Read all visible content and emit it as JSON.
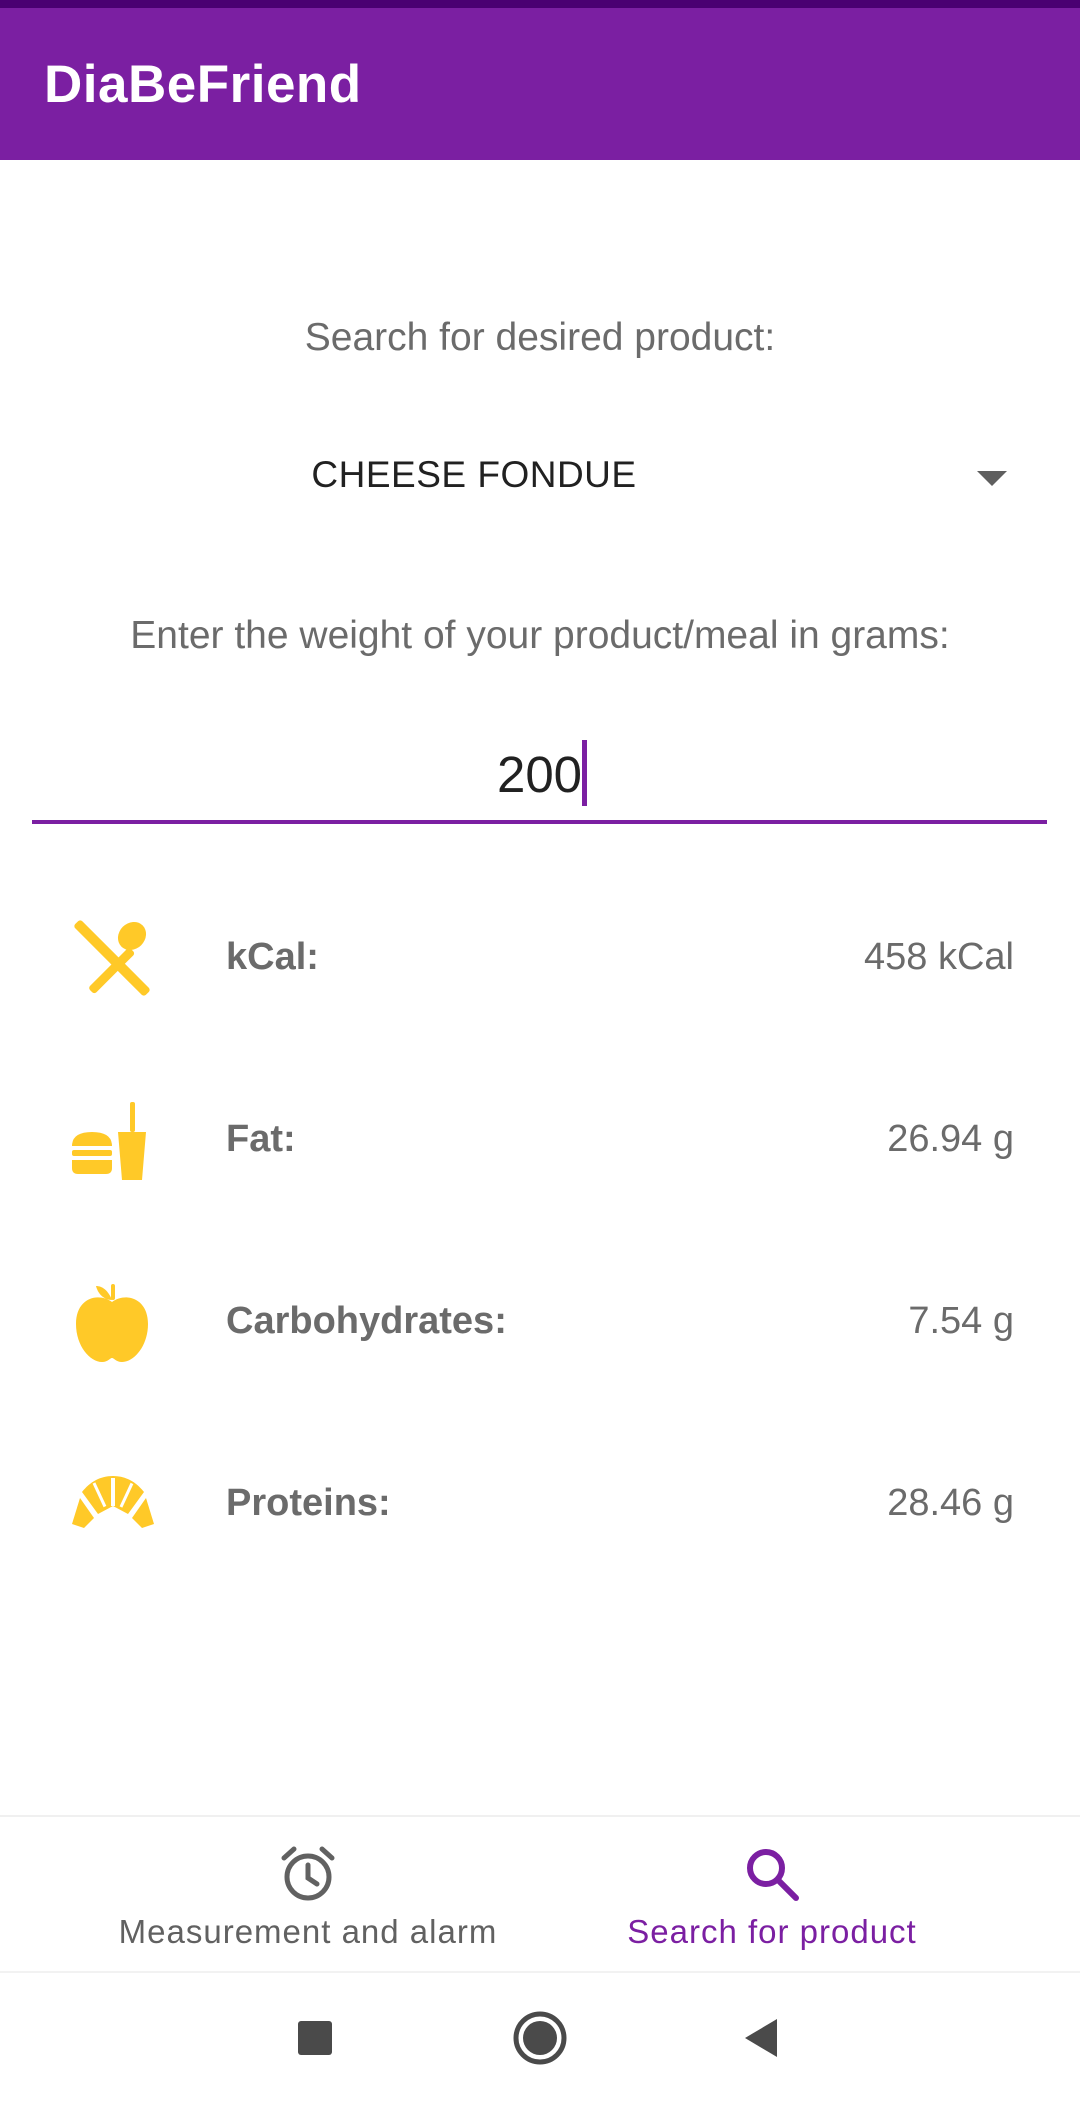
{
  "app": {
    "title": "DiaBeFriend"
  },
  "colors": {
    "primary": "#7B1FA2",
    "icon_accent": "#FFC928",
    "label": "#6b6b6b"
  },
  "search": {
    "label": "Search for desired product:",
    "selected_product": "CHEESE FONDUE"
  },
  "weight": {
    "label": "Enter the weight of your product/meal in grams:",
    "value": "200"
  },
  "nutrients": [
    {
      "icon": "fork-spoon-icon",
      "label": "kCal:",
      "value": "458 kCal"
    },
    {
      "icon": "burger-drink-icon",
      "label": "Fat:",
      "value": "26.94 g"
    },
    {
      "icon": "apple-icon",
      "label": "Carbohydrates:",
      "value": "7.54 g"
    },
    {
      "icon": "croissant-icon",
      "label": "Proteins:",
      "value": "28.46 g"
    }
  ],
  "bottom_nav": {
    "items": [
      {
        "icon": "alarm-clock-icon",
        "label": "Measurement and alarm",
        "active": false
      },
      {
        "icon": "search-icon",
        "label": "Search for product",
        "active": true
      }
    ]
  },
  "system_nav": [
    "recents-square-icon",
    "home-circle-icon",
    "back-triangle-icon"
  ]
}
